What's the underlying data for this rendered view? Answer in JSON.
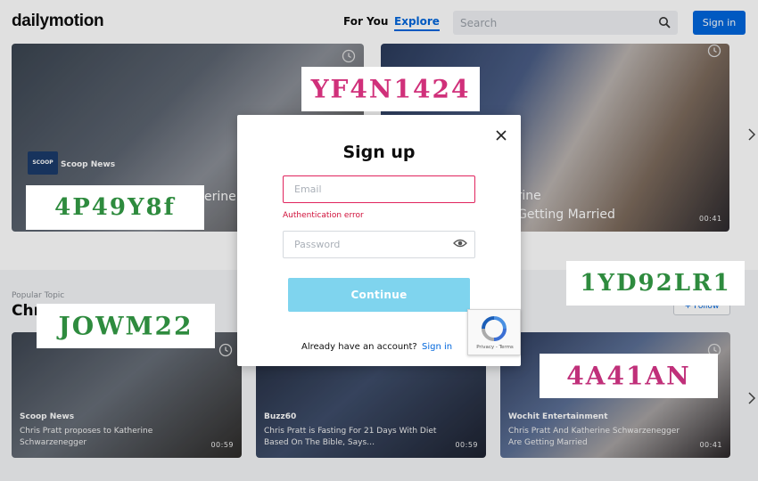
{
  "header": {
    "logo": "dailymotion",
    "nav_for_you": "For You",
    "nav_explore": "Explore",
    "search_placeholder": "Search",
    "signin_label": "Sign in"
  },
  "top_row": {
    "card1": {
      "channel": "Scoop News",
      "channel_logo": "SCOOP",
      "title_fragment": "erine"
    },
    "card2": {
      "title_line1": "erine",
      "title_line2": "e Getting Married",
      "duration": "00:41"
    }
  },
  "section": {
    "eyebrow": "Popular Topic",
    "title": "Chr",
    "follow_label": "+ Follow"
  },
  "cards": [
    {
      "channel": "Scoop News",
      "title": "Chris Pratt proposes to Katherine Schwarzenegger",
      "duration": "00:59"
    },
    {
      "channel": "Buzz60",
      "title": "Chris Pratt is Fasting For 21 Days With Diet Based On The Bible, Says…",
      "duration": "00:59"
    },
    {
      "channel": "Wochit Entertainment",
      "title": "Chris Pratt And Katherine Schwarzenegger Are Getting Married",
      "duration": "00:41"
    }
  ],
  "modal": {
    "title": "Sign up",
    "email_placeholder": "Email",
    "error_text": "Authentication error",
    "password_placeholder": "Password",
    "continue_label": "Continue",
    "already_text": "Already have an account?",
    "signin_link": "Sign in"
  },
  "recaptcha": {
    "links": "Privacy - Terms"
  },
  "captchas": [
    {
      "text": "YF4N1424",
      "color": "#d0307a"
    },
    {
      "text": "4P49Y8f",
      "color": "#2e8b3e"
    },
    {
      "text": "1YD92LR1",
      "color": "#2e8b3e"
    },
    {
      "text": "JOWM22",
      "color": "#2e8b3e"
    },
    {
      "text": "4A41AN",
      "color": "#c0307a"
    }
  ],
  "colors": {
    "accent": "#0066dc",
    "error": "#d0103a",
    "continue": "#7fd4ee"
  }
}
